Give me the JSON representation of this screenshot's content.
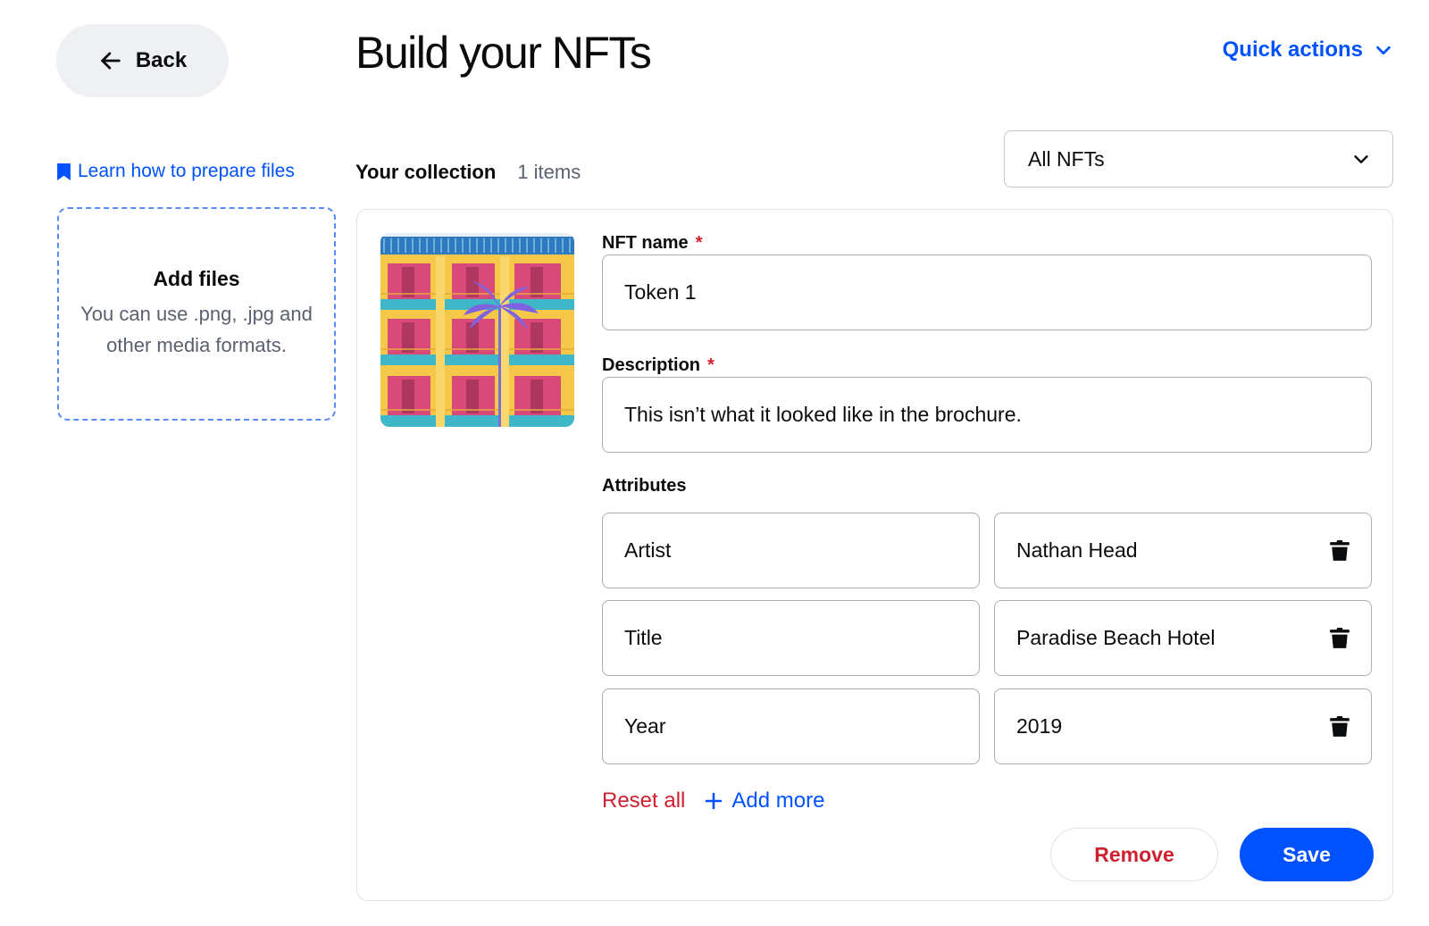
{
  "header": {
    "back_label": "Back",
    "title": "Build your NFTs",
    "quick_actions_label": "Quick actions"
  },
  "sidebar": {
    "learn_link": "Learn how to prepare files",
    "add_files": {
      "title": "Add files",
      "description": "You can use .png, .jpg and other media formats."
    }
  },
  "collection": {
    "title": "Your collection",
    "count": "1 items",
    "filter_selected": "All NFTs"
  },
  "nft": {
    "name_label": "NFT name",
    "name_value": "Token 1",
    "description_label": "Description",
    "description_value": "This isn’t what it looked like in the brochure.",
    "required_mark": "*",
    "attributes_label": "Attributes",
    "attributes": [
      {
        "key": "Artist",
        "value": "Nathan Head"
      },
      {
        "key": "Title",
        "value": "Paradise Beach Hotel"
      },
      {
        "key": "Year",
        "value": "2019"
      }
    ],
    "reset_label": "Reset all",
    "add_more_label": "Add more",
    "remove_label": "Remove",
    "save_label": "Save"
  },
  "colors": {
    "accent": "#0052ff",
    "danger": "#cf202f",
    "muted_text": "#5b616e",
    "back_button_bg": "#eef0f3"
  },
  "icons": {
    "back": "arrow-left-icon",
    "quick_actions": "chevron-down-icon",
    "learn": "bookmark-icon",
    "filter": "chevron-down-icon",
    "delete": "trash-icon",
    "add": "plus-icon"
  }
}
